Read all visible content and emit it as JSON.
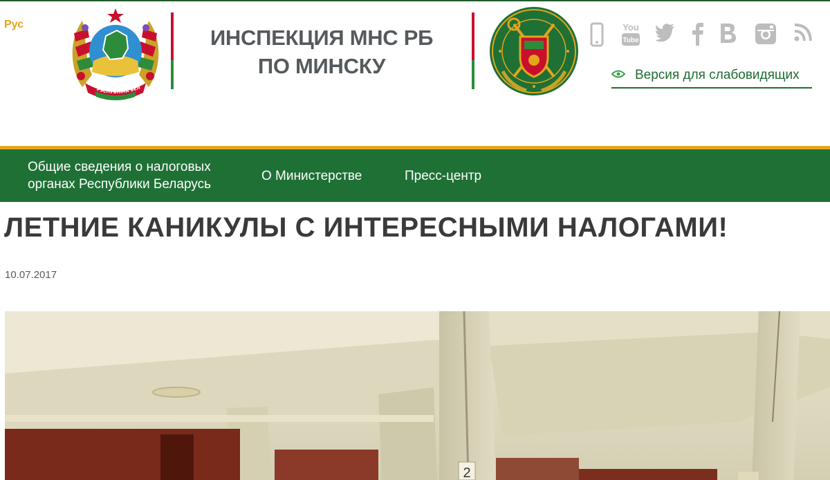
{
  "header": {
    "language": "Рус",
    "title_line1": "ИНСПЕКЦИЯ МНС РБ",
    "title_line2": "ПО МИНСКУ",
    "emblem_left_ribbon": "РЭСПУБЛІКА БЕЛАРУСЬ",
    "accessibility_link": "Версия для слабовидящих",
    "social_icons": [
      "mobile-icon",
      "youtube-icon",
      "twitter-icon",
      "facebook-icon",
      "vkontakte-icon",
      "instagram-icon",
      "rss-icon"
    ],
    "youtube_you": "You",
    "youtube_tube": "Tube"
  },
  "nav": {
    "items": [
      {
        "line1": "Общие сведения о налоговых",
        "line2": "органах Республики Беларусь"
      },
      {
        "label": "О Министерстве"
      },
      {
        "label": "Пресс-центр"
      }
    ]
  },
  "article": {
    "title": "ЛЕТНИЕ КАНИКУЛЫ С ИНТЕРЕСНЫМИ НАЛОГАМИ!",
    "date": "10.07.2017",
    "photo_number": "2"
  },
  "colors": {
    "brand_green": "#1f7035",
    "accent_gold": "#e3a51c",
    "flag_red": "#c8102e",
    "title_gray": "#555a5c"
  }
}
